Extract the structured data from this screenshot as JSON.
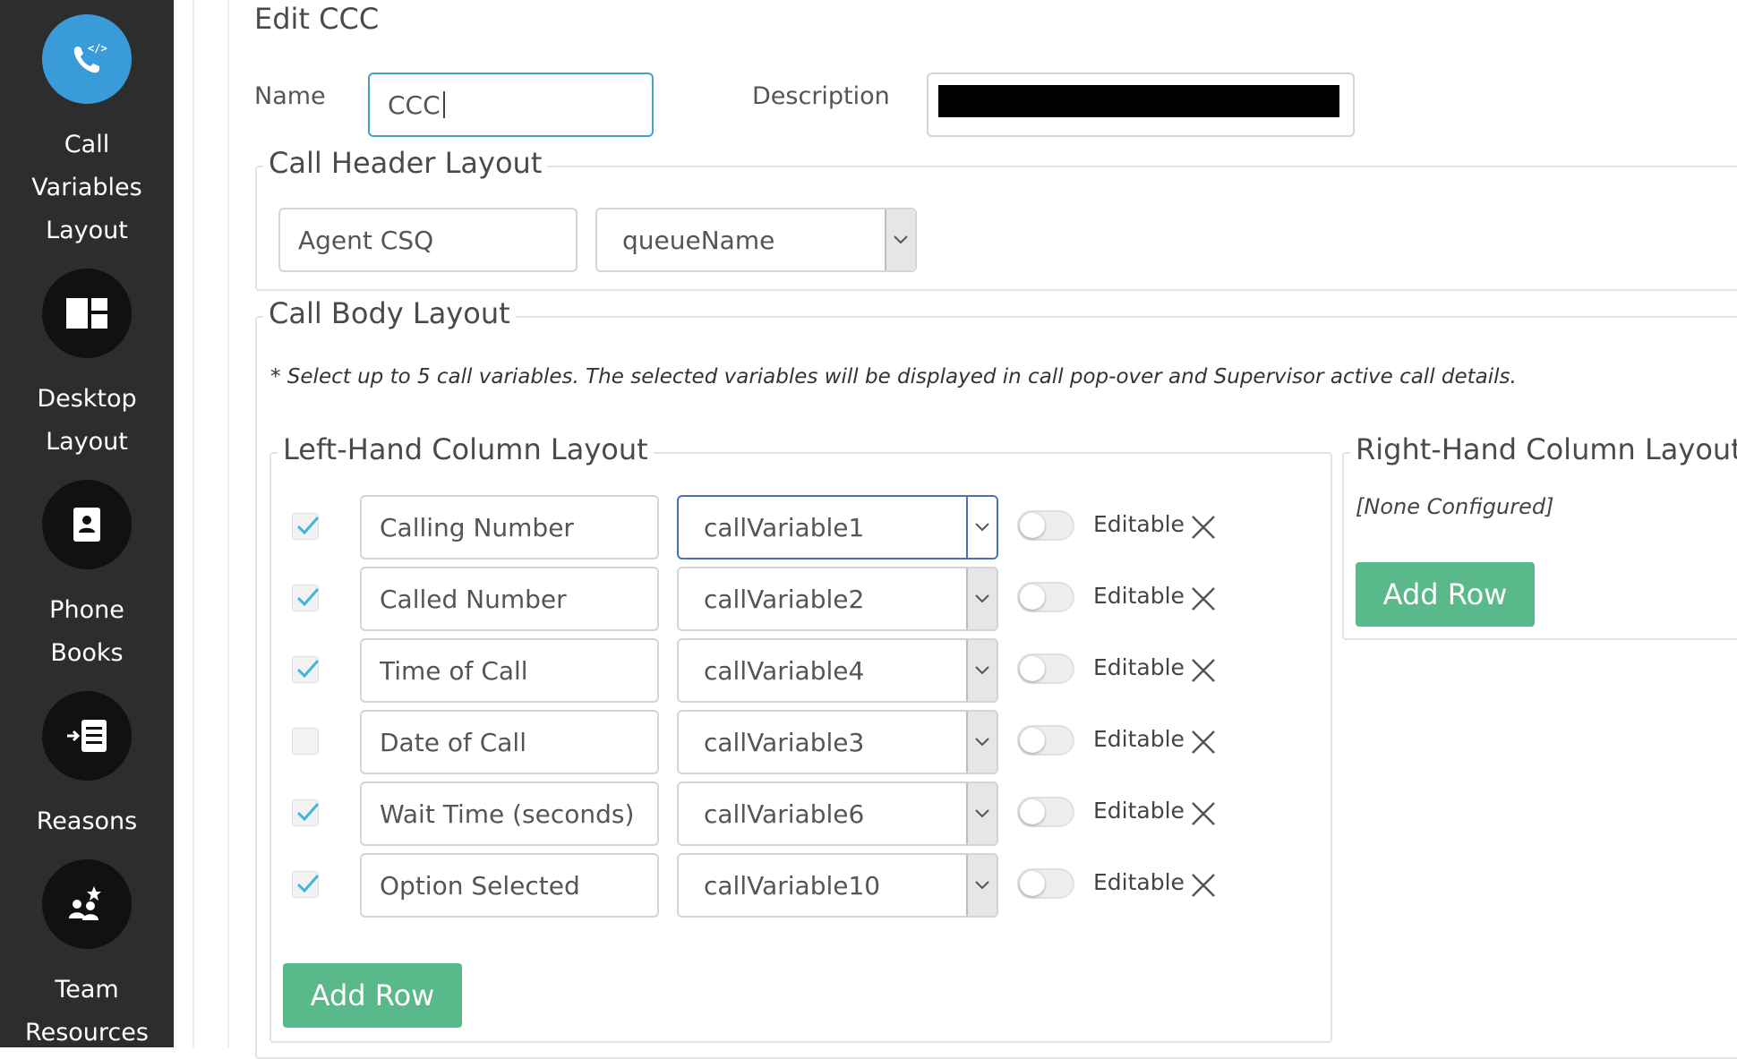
{
  "sidebar": {
    "items": [
      {
        "label": "Call\nVariables\nLayout",
        "icon": "call-variables-icon",
        "active": true
      },
      {
        "label": "Desktop\nLayout",
        "icon": "desktop-layout-icon"
      },
      {
        "label": "Phone\nBooks",
        "icon": "phone-books-icon"
      },
      {
        "label": "Reasons",
        "icon": "reasons-icon"
      },
      {
        "label": "Team\nResources",
        "icon": "team-resources-icon"
      }
    ]
  },
  "form": {
    "title": "Edit CCC",
    "name_label": "Name",
    "name_value": "CCC",
    "description_label": "Description"
  },
  "header_layout": {
    "legend": "Call Header Layout",
    "display_name": "Agent CSQ",
    "variable": "queueName"
  },
  "body_layout": {
    "legend": "Call Body Layout",
    "note": "* Select up to 5 call variables. The selected variables will be displayed in call pop-over and Supervisor active call details.",
    "left": {
      "legend": "Left-Hand Column Layout",
      "editable_label": "Editable",
      "add_row_label": "Add Row",
      "rows": [
        {
          "checked": true,
          "display_name": "Calling Number",
          "variable": "callVariable1",
          "editable": false
        },
        {
          "checked": true,
          "display_name": "Called Number",
          "variable": "callVariable2",
          "editable": false
        },
        {
          "checked": true,
          "display_name": "Time of Call",
          "variable": "callVariable4",
          "editable": false
        },
        {
          "checked": false,
          "display_name": "Date of Call",
          "variable": "callVariable3",
          "editable": false
        },
        {
          "checked": true,
          "display_name": "Wait Time (seconds)",
          "variable": "callVariable6",
          "editable": false
        },
        {
          "checked": true,
          "display_name": "Option Selected",
          "variable": "callVariable10",
          "editable": false
        }
      ]
    },
    "right": {
      "legend": "Right-Hand Column Layout",
      "empty_text": "[None Configured]",
      "add_row_label": "Add Row"
    }
  },
  "colors": {
    "sidebar_bg": "#2d2d2d",
    "active_icon": "#3a9bd9",
    "button_green": "#5ab98a",
    "checkmark": "#43b4d6"
  }
}
